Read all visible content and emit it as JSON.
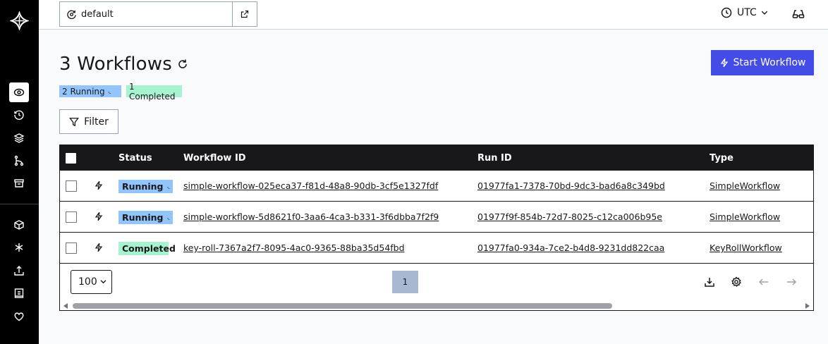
{
  "topbar": {
    "namespace": "default",
    "timezone": "UTC"
  },
  "header": {
    "title": "3 Workflows",
    "start_button": "Start Workflow",
    "badge_running": "2 Running",
    "badge_completed": "1 Completed",
    "filter_button": "Filter"
  },
  "table": {
    "columns": [
      "Status",
      "Workflow ID",
      "Run ID",
      "Type"
    ],
    "rows": [
      {
        "status": "Running",
        "workflow_id": "simple-workflow-025eca37-f81d-48a8-90db-3cf5e1327fdf",
        "run_id": "01977fa1-7378-70bd-9dc3-bad6a8c349bd",
        "type": "SimpleWorkflow"
      },
      {
        "status": "Running",
        "workflow_id": "simple-workflow-5d8621f0-3aa6-4ca3-b331-3f6dbba7f2f9",
        "run_id": "01977f9f-854b-72d7-8025-c12ca006b95e",
        "type": "SimpleWorkflow"
      },
      {
        "status": "Completed",
        "workflow_id": "key-roll-7367a2f7-8095-4ac0-9365-88ba35d54fbd",
        "run_id": "01977fa0-934a-7ce2-b4d8-9231dd822caa",
        "type": "KeyRollWorkflow"
      }
    ]
  },
  "footer": {
    "page_size": "100",
    "current_page": "1"
  },
  "icons": [
    "logo-icon",
    "workflows-icon",
    "schedules-icon",
    "batch-icon",
    "deployments-icon",
    "archive-icon",
    "nexus-icon",
    "integrations-icon",
    "import-icon",
    "docs-icon",
    "feedback-icon",
    "namespace-icon",
    "external-link-icon",
    "clock-icon",
    "glasses-icon",
    "refresh-icon",
    "bolt-icon",
    "filter-icon",
    "download-icon",
    "settings-icon",
    "arrow-left-icon",
    "arrow-right-icon"
  ],
  "colors": {
    "accent": "#444ce7",
    "running": "#93c5fd",
    "completed": "#a7f3d0",
    "nav_bg": "#000000"
  }
}
